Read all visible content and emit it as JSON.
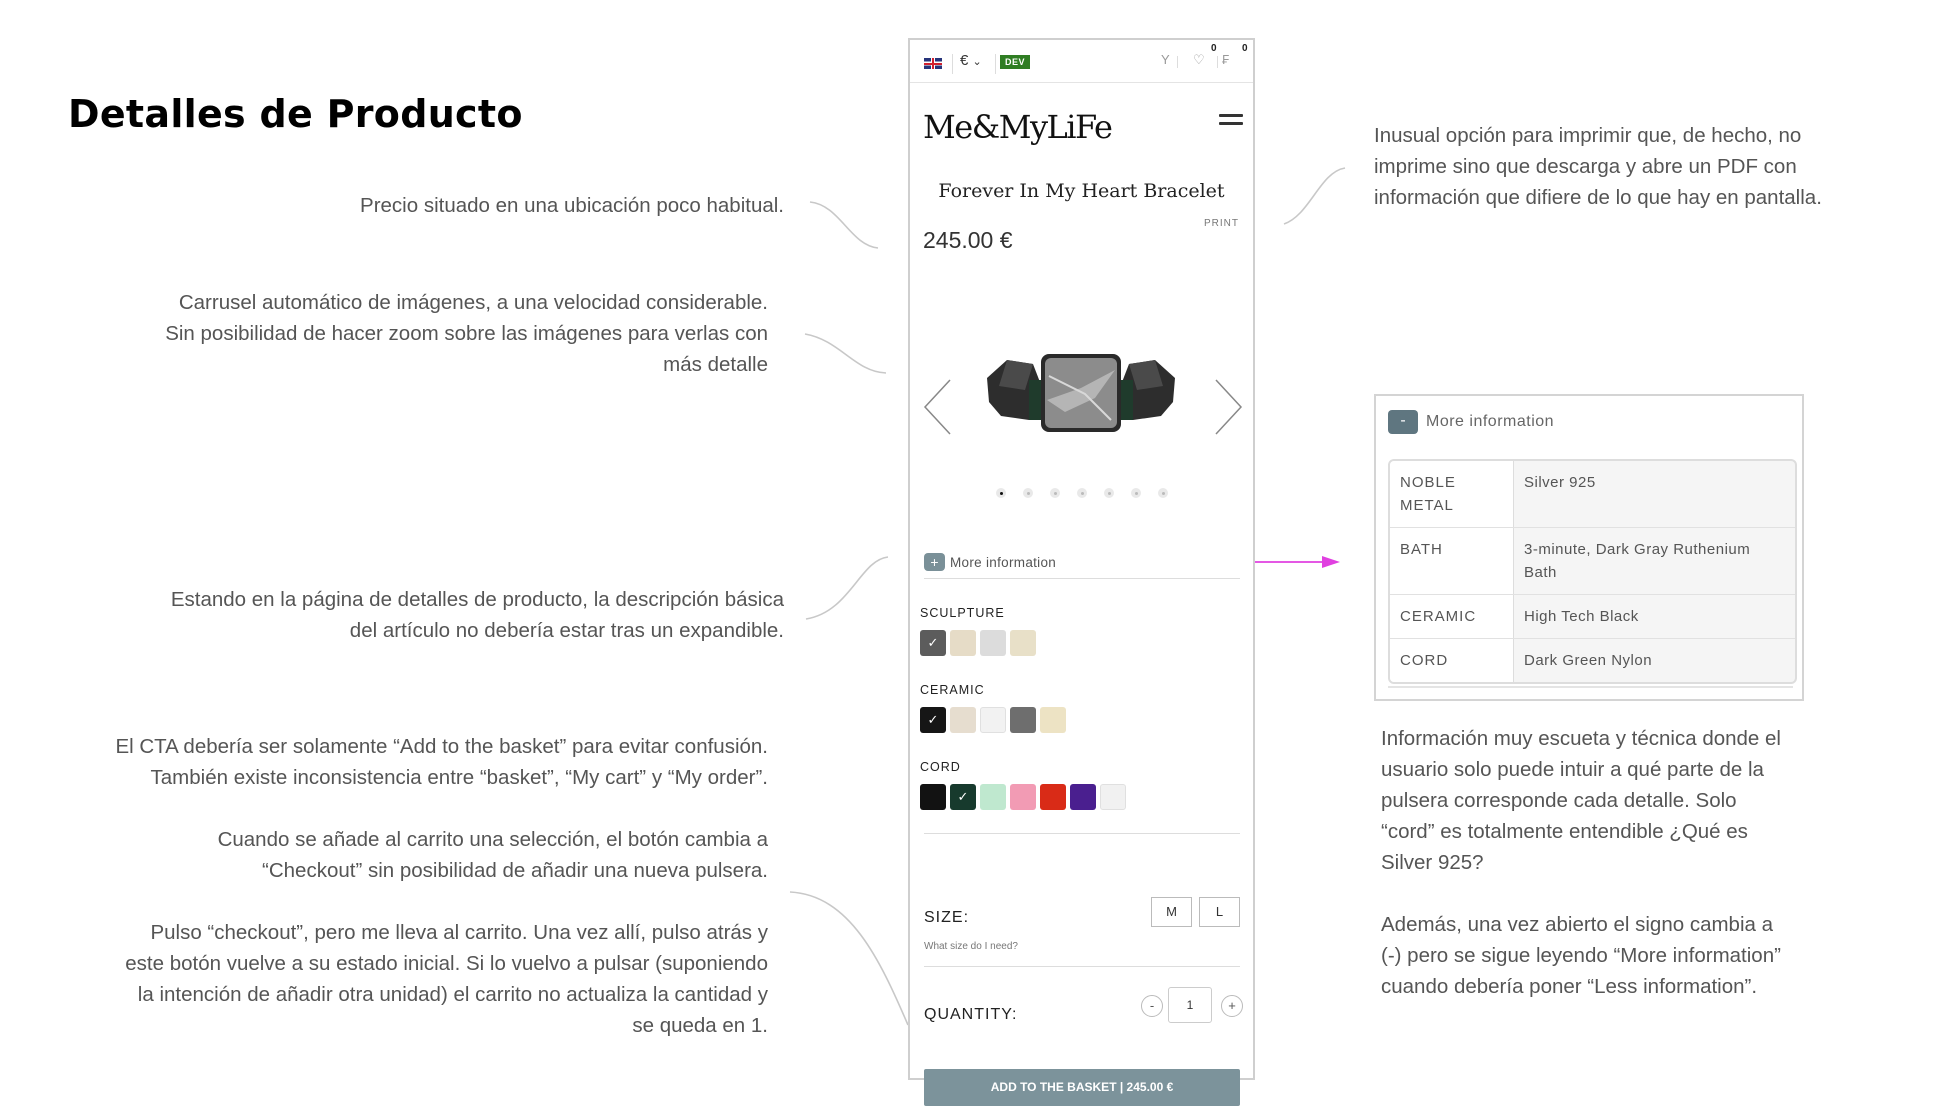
{
  "slide": {
    "title": "Detalles de Producto"
  },
  "annotations": {
    "price": [
      "Precio situado en una ubicación poco habitual."
    ],
    "carousel": [
      "Carrusel automático de imágenes, a una velocidad considerable.",
      "Sin posibilidad de hacer zoom sobre las imágenes para verlas con",
      "más detalle"
    ],
    "expandable": [
      "Estando en la página de detalles de producto, la descripción básica",
      "del artículo no debería estar tras un expandible."
    ],
    "cta": [
      "El CTA debería ser solamente “Add to the basket” para evitar confusión.",
      "También existe inconsistencia entre “basket”, “My cart” y “My order”.",
      "",
      "Cuando se añade al carrito una selección, el botón cambia a",
      "“Checkout” sin posibilidad de añadir una nueva pulsera.",
      "",
      "Pulso “checkout”, pero me lleva al carrito. Una vez allí, pulso atrás y",
      "este botón vuelve a su estado inicial. Si lo vuelvo a pulsar (suponiendo",
      "la intención de añadir otra unidad) el carrito no actualiza la cantidad y",
      "se queda en 1."
    ],
    "print": [
      "Inusual opción para imprimir que, de hecho, no",
      "imprime sino que descarga y abre un PDF con",
      "información que difiere de lo que hay en pantalla."
    ],
    "info": [
      "Información muy escueta y técnica donde el",
      "usuario solo puede intuir a qué parte de la",
      "pulsera corresponde cada detalle. Solo",
      "“cord” es totalmente entendible ¿Qué es",
      "Silver 925?",
      "",
      "Además, una vez abierto el signo cambia a",
      "(-) pero se sigue leyendo “More information”",
      "cuando debería poner “Less information”."
    ]
  },
  "phone": {
    "currency": "€",
    "dev_badge": "DEV",
    "wishlist_count": "0",
    "cart_count": "0",
    "logo": "Me&MyLiFe",
    "product_name": "Forever In My Heart Bracelet",
    "print_label": "PRINT",
    "price": "245.00 €",
    "carousel_dot_count": 7,
    "more_info_label": "More information",
    "sculpture_label": "SCULPTURE",
    "ceramic_label": "CERAMIC",
    "cord_label": "CORD",
    "sculpture_colors": [
      "#5c5c5c",
      "#e6dcc7",
      "#dcdcdc",
      "#e8e0c8"
    ],
    "ceramic_colors": [
      "#161616",
      "#e6ddcf",
      "#f2f2f2",
      "#6e6e6e",
      "#ede3c4"
    ],
    "cord_colors": [
      "#121212",
      "#173a2d",
      "#bfe8cf",
      "#f29bb4",
      "#d92b17",
      "#4a1f8f",
      "#f1f1f1"
    ],
    "size_label": "SIZE:",
    "size_options": [
      "M",
      "L"
    ],
    "size_help": "What size do I need?",
    "quantity_label": "QUANTITY:",
    "quantity_value": "1",
    "qty_minus": "-",
    "qty_plus": "+",
    "cta_label": "ADD TO THE BASKET | 245.00 €"
  },
  "info_panel": {
    "toggle_symbol": "-",
    "title": "More information",
    "rows": [
      {
        "key": "NOBLE METAL",
        "value": "Silver 925"
      },
      {
        "key": "BATH",
        "value": "3-minute, Dark Gray Ruthenium Bath"
      },
      {
        "key": "CERAMIC",
        "value": "High Tech Black"
      },
      {
        "key": "CORD",
        "value": "Dark Green Nylon"
      }
    ]
  },
  "colors": {
    "accent_arrow": "#e040e0",
    "cta_bg": "#7c939b",
    "dev_green": "#2f7d23"
  }
}
